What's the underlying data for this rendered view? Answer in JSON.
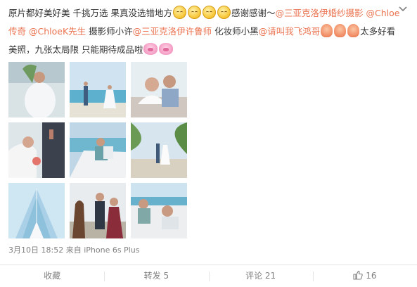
{
  "post": {
    "text_part1": "原片都好美好美 千挑万选 果真没选错地方",
    "text_part2": "感谢感谢～",
    "mention1": "@三亚克洛伊婚纱摄影",
    "mention2": "@Chloe传奇",
    "mention3": "@ChloeK先生",
    "text_part3": " 摄影师小许",
    "mention4": "@三亚克洛伊许鲁师",
    "text_part4": " 化妆师小黑",
    "mention5": "@请叫我飞鸿哥",
    "text_part5": "太多好看美照，九张太局限 只能期待成品啦",
    "emoji_smile": "smile-emoji",
    "emoji_hand": "fist-emoji",
    "emoji_pig": "pig-emoji"
  },
  "photos": [
    {
      "alt": "photo-1"
    },
    {
      "alt": "photo-2"
    },
    {
      "alt": "photo-3"
    },
    {
      "alt": "photo-4"
    },
    {
      "alt": "photo-5"
    },
    {
      "alt": "photo-6"
    },
    {
      "alt": "photo-7"
    },
    {
      "alt": "photo-8"
    },
    {
      "alt": "photo-9"
    }
  ],
  "meta": {
    "date": "3月10日 18:52",
    "from": "来自",
    "device": "iPhone 6s Plus"
  },
  "actions": {
    "favorite": "收藏",
    "repost": "转发 5",
    "comment": "评论 21",
    "like_count": "16"
  },
  "colors": {
    "mention": "#eb7350",
    "meta": "#808080"
  }
}
